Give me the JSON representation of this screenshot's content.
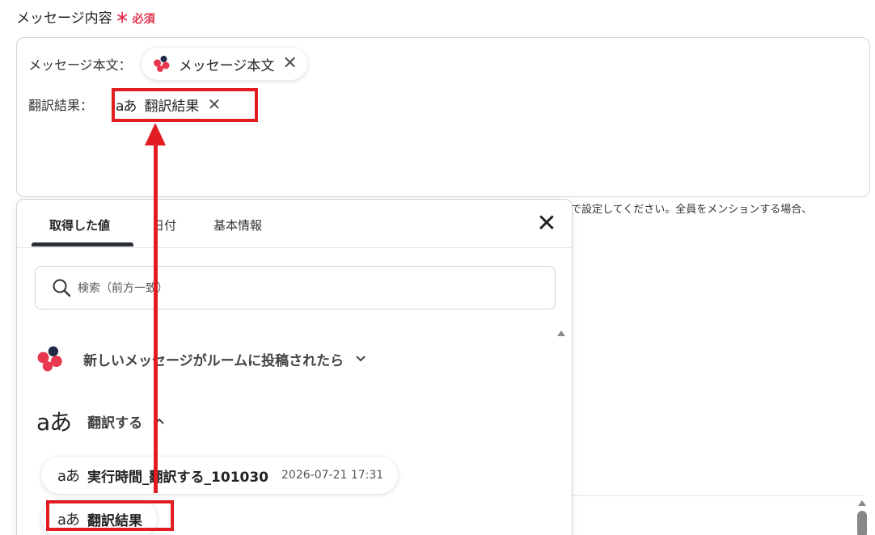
{
  "field": {
    "label": "メッセージ内容",
    "required_star": "＊",
    "required_text": "必須"
  },
  "message_box": {
    "row1_label": "メッセージ本文：",
    "row1_chip": "メッセージ本文",
    "row2_label": "翻訳結果：",
    "row2_chip": "翻訳結果",
    "chip_remove": "✕"
  },
  "hint_text": "で設定してください。全員をメンションする場合、",
  "panel": {
    "tabs": [
      "取得した値",
      "日付",
      "基本情報"
    ],
    "active_tab": "取得した値",
    "close": "✕",
    "search_placeholder": "検索（前方一致）",
    "groups": [
      {
        "label": "新しいメッセージがルームに投稿されたら",
        "chevron": "⌄",
        "icon": "chatwork-logo-icon"
      },
      {
        "label": "翻訳する",
        "chevron": "⌃",
        "icon": "translate-aa-icon"
      }
    ],
    "items": [
      {
        "name": "実行時間_翻訳する_101030",
        "value": "2026-07-21 17:31"
      },
      {
        "name": "翻訳結果",
        "value": ""
      }
    ]
  },
  "icons": {
    "aa": "aあ"
  },
  "colors": {
    "required": "#e0314b",
    "highlight": "#e11d22",
    "logo_red": "#e8384f",
    "logo_dark": "#1f2a44"
  }
}
